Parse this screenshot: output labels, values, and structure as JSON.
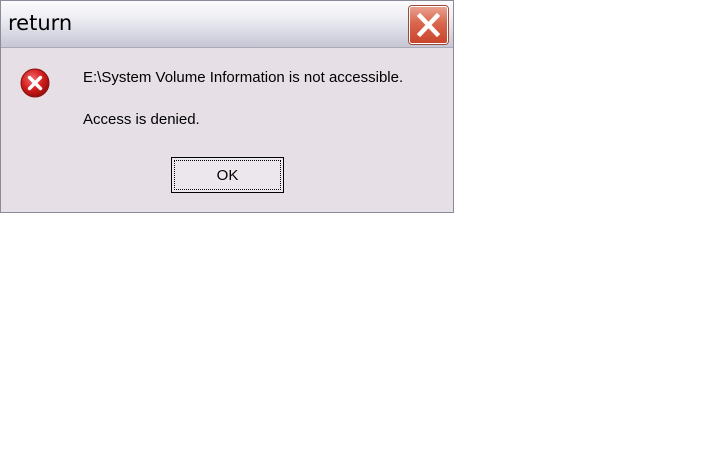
{
  "dialog": {
    "title": "return",
    "close_icon": "close-icon",
    "error_icon": "error-icon",
    "message_line1": "E:\\System Volume Information is not accessible.",
    "message_line2": "Access is denied.",
    "ok_label": "OK"
  },
  "colors": {
    "dialog_background": "#e6e0e6",
    "close_button": "#d9664d",
    "error_icon": "#c8102e"
  }
}
